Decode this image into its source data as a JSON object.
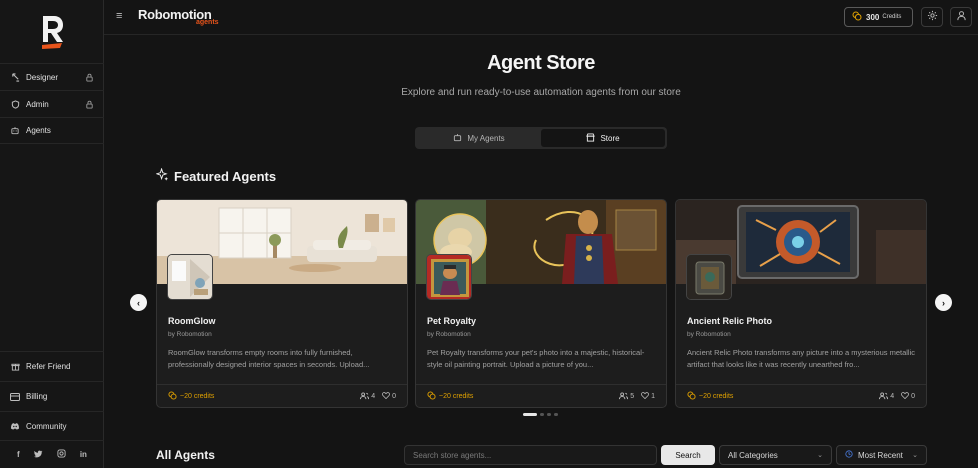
{
  "sidebar": {
    "nav": [
      {
        "label": "Designer",
        "icon": "designer-icon",
        "locked": true
      },
      {
        "label": "Admin",
        "icon": "shield-icon",
        "locked": true
      },
      {
        "label": "Agents",
        "icon": "robot-icon",
        "locked": false
      }
    ],
    "bottom": [
      {
        "label": "Refer Friend",
        "icon": "gift-icon"
      },
      {
        "label": "Billing",
        "icon": "credit-card-icon"
      },
      {
        "label": "Community",
        "icon": "discord-icon"
      }
    ],
    "socials": [
      "f",
      "t",
      "ig",
      "in"
    ]
  },
  "header": {
    "brand": "Robomotion",
    "brand_sub": "agents",
    "credits_value": "300",
    "credits_label": "Credits"
  },
  "main": {
    "title": "Agent Store",
    "subtitle": "Explore and run ready-to-use automation agents from our store",
    "tabs": [
      {
        "label": "My Agents",
        "active": false
      },
      {
        "label": "Store",
        "active": true
      }
    ],
    "featured_title": "Featured Agents",
    "cards": [
      {
        "name": "RoomGlow",
        "by": "by Robomotion",
        "desc": "RoomGlow transforms empty rooms into fully furnished, professionally designed interior spaces in seconds. Upload...",
        "credits": "~20 credits",
        "users": "4",
        "likes": "0"
      },
      {
        "name": "Pet Royalty",
        "by": "by Robomotion",
        "desc": "Pet Royalty transforms your pet's photo into a majestic, historical-style oil painting portrait. Upload a picture of you...",
        "credits": "~20 credits",
        "users": "5",
        "likes": "1"
      },
      {
        "name": "Ancient Relic Photo",
        "by": "by Robomotion",
        "desc": "Ancient Relic Photo transforms any picture into a mysterious metallic artifact that looks like it was recently unearthed fro...",
        "credits": "~20 credits",
        "users": "4",
        "likes": "0"
      }
    ],
    "carousel_pages": 4,
    "carousel_active": 0,
    "all_title": "All Agents",
    "search_placeholder": "Search store agents...",
    "search_button": "Search",
    "category_select": "All Categories",
    "sort_select": "Most Recent"
  },
  "colors": {
    "accent_orange": "#e8541b",
    "credit_gold": "#e0a100",
    "background": "#141414"
  }
}
